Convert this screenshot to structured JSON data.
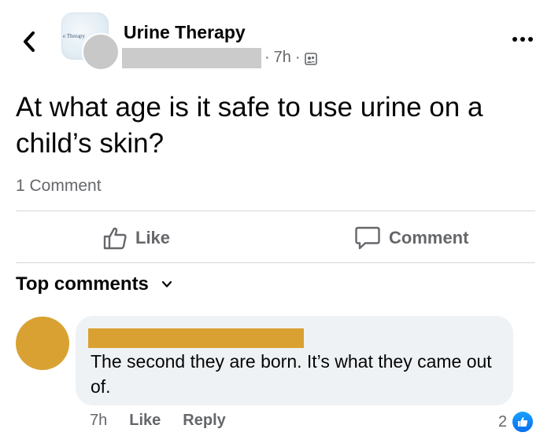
{
  "header": {
    "group_name": "Urine Therapy",
    "group_logo_text": "e Therapy",
    "timestamp": "7h",
    "separator": "·"
  },
  "post": {
    "text": "At what age is it safe to use urine on a child’s skin?",
    "comment_count": "1 Comment"
  },
  "actions": {
    "like_label": "Like",
    "comment_label": "Comment"
  },
  "comments_section": {
    "sort_label": "Top comments"
  },
  "comment": {
    "text": "The second they are born. It’s what they came out of.",
    "time": "7h",
    "like_label": "Like",
    "reply_label": "Reply",
    "reaction_count": "2"
  },
  "icons": {
    "back": "chevron-left-icon",
    "more": "more-dots-icon",
    "audience": "group-audience-icon",
    "like": "thumbs-up-icon",
    "comment": "speech-bubble-icon",
    "sort": "chevron-down-icon",
    "reaction": "like-reaction-icon"
  },
  "colors": {
    "redaction_gray": "#cbcbcb",
    "redaction_gold": "#d9a132",
    "secondary_text": "#65676b",
    "like_blue": "#0a6ef0"
  }
}
